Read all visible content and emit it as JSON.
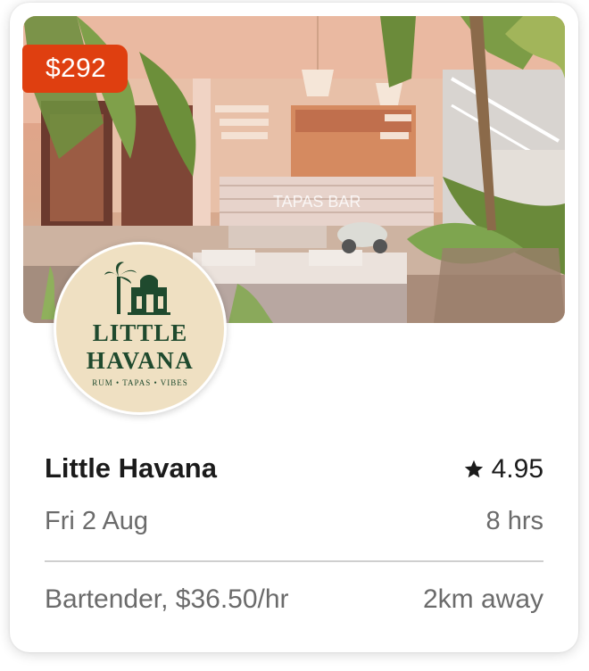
{
  "shift_card": {
    "price_badge": "$292",
    "venue_name": "Little Havana",
    "rating": "4.95",
    "date": "Fri 2 Aug",
    "duration": "8 hrs",
    "role_rate": "Bartender, $36.50/hr",
    "distance": "2km away",
    "logo": {
      "line1": "LITTLE",
      "line2": "HAVANA",
      "tagline": "RUM • TAPAS • VIBES"
    },
    "photo": {
      "sign_text": "TAPAS BAR"
    },
    "icons": {
      "rating": "star-icon"
    },
    "colors": {
      "badge": "#df3f10",
      "logo_green": "#1f4a2e",
      "logo_bg": "#efe0c2"
    }
  }
}
